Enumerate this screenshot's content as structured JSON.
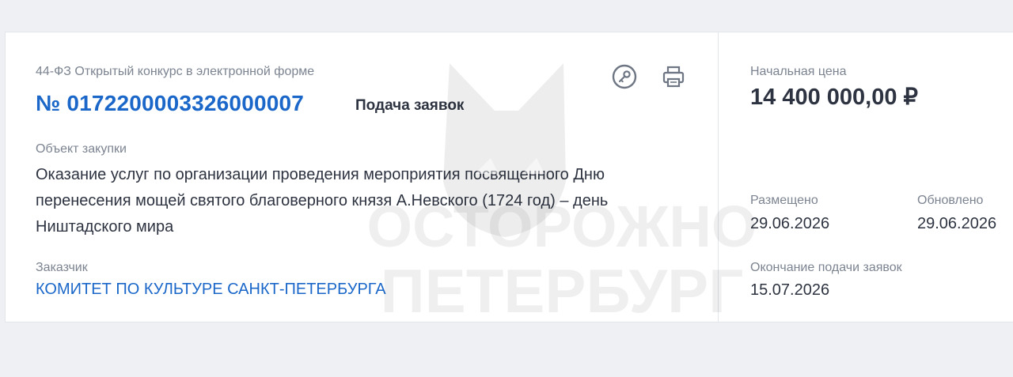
{
  "notice": {
    "law_type": "44-ФЗ Открытый конкурс в электронной форме",
    "number": "№ 0172200003326000007",
    "stage": "Подача заявок",
    "object_label": "Объект закупки",
    "object_text": "Оказание услуг по организации проведения мероприятия посвященного Дню перенесения мощей святого благоверного князя А.Невского (1724 год) – день Ништадского мира",
    "customer_label": "Заказчик",
    "customer_name": "КОМИТЕТ ПО КУЛЬТУРЕ САНКТ-ПЕТЕРБУРГА"
  },
  "actions": {
    "key_icon": "key-circle-icon",
    "print_icon": "printer-icon"
  },
  "side": {
    "price_label": "Начальная цена",
    "price_value": "14 400 000,00 ₽",
    "posted_label": "Размещено",
    "posted_value": "29.06.2026",
    "updated_label": "Обновлено",
    "updated_value": "29.06.2026",
    "deadline_label": "Окончание подачи заявок",
    "deadline_value": "15.07.2026"
  },
  "watermark": {
    "line1": "ОСТОРОЖНО",
    "line2": "ПЕТЕРБУРГ"
  },
  "colors": {
    "link": "#1a67c9",
    "text": "#2d3340",
    "muted": "#7c8491",
    "background": "#eef0f3"
  }
}
